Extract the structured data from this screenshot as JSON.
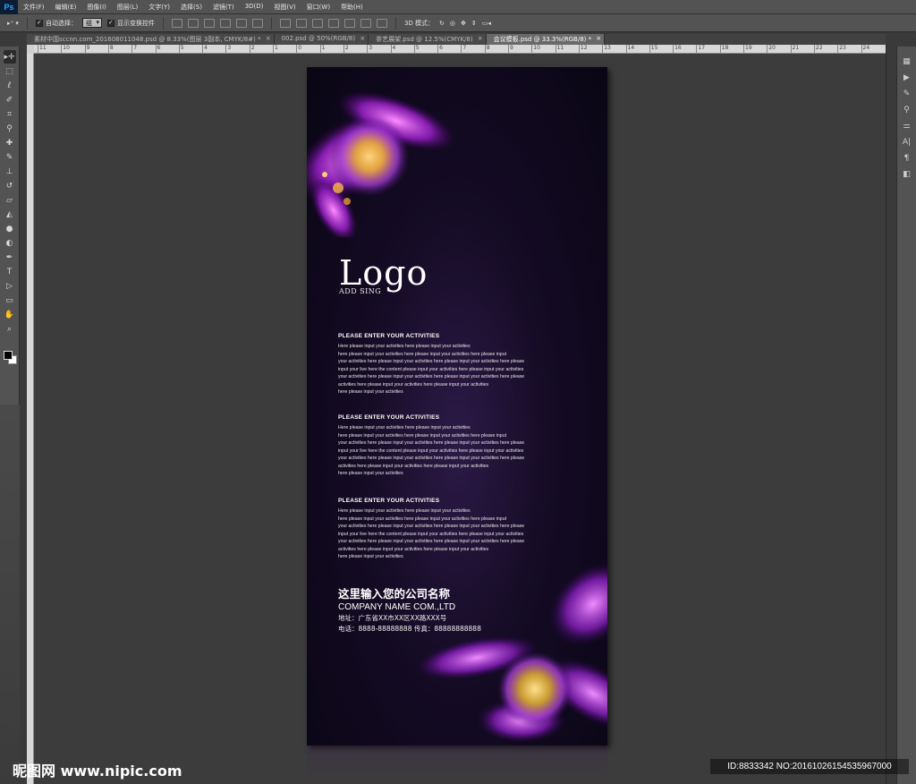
{
  "app": {
    "logo": "Ps"
  },
  "menu": [
    "文件(F)",
    "编辑(E)",
    "图像(I)",
    "图层(L)",
    "文字(Y)",
    "选择(S)",
    "滤镜(T)",
    "3D(D)",
    "视图(V)",
    "窗口(W)",
    "帮助(H)"
  ],
  "options": {
    "auto_select_label": "自动选择：",
    "auto_select_value": "组",
    "show_transform_label": "显示变换控件",
    "mode_3d_label": "3D 模式："
  },
  "tabs": [
    {
      "label": "素材中国sccnn.com_201608011048.psd @ 8.33%(图层 3副本, CMYK/8#) *",
      "active": false
    },
    {
      "label": "002.psd @ 50%(RGB/8)",
      "active": false
    },
    {
      "label": "茶艺展架.psd @ 12.5%(CMYK/8)",
      "active": false
    },
    {
      "label": "会议模板.psd @ 33.3%(RGB/8) *",
      "active": true
    }
  ],
  "ruler_ticks": [
    "11",
    "10",
    "9",
    "8",
    "7",
    "6",
    "5",
    "4",
    "3",
    "2",
    "1",
    "0",
    "1",
    "2",
    "3",
    "4",
    "5",
    "6",
    "7",
    "8",
    "9",
    "10",
    "11",
    "12",
    "13",
    "14",
    "15",
    "16",
    "17",
    "18",
    "19",
    "20",
    "21",
    "22",
    "23",
    "24"
  ],
  "tools": [
    "move-icon",
    "marquee-icon",
    "lasso-icon",
    "quick-select-icon",
    "crop-icon",
    "eyedropper-icon",
    "healing-icon",
    "brush-icon",
    "stamp-icon",
    "history-brush-icon",
    "eraser-icon",
    "bucket-icon",
    "blur-icon",
    "dodge-icon",
    "pen-icon",
    "type-icon",
    "path-select-icon",
    "shape-icon",
    "hand-icon",
    "zoom-icon"
  ],
  "poster": {
    "logo": "Logo",
    "logo_sub": "ADD SING",
    "sections": [
      {
        "title": "PLEASE ENTER YOUR ACTIVITIES",
        "lines": [
          "Here please input your activities here please input your activities",
          "here please input your activities here please input your activities here please input",
          "your activities here please input your activities here please input your activities here please",
          "input your live here the content please input your activities here please input your activities",
          "your activities here please input your activities here please input your activities here please",
          " activities here please input your activities here please input your activities",
          "here please input your activities"
        ]
      },
      {
        "title": "PLEASE ENTER YOUR ACTIVITIES",
        "lines": [
          "Here please input your activities here please input your activities",
          "here please input your activities here please input your activities here please input",
          "your activities here please input your activities here please input your activities here please",
          "input your live here the content please input your activities here please input your activities",
          "your activities here please input your activities here please input your activities here please",
          " activities here please input your activities here please input your activities",
          "here please input your activities"
        ]
      },
      {
        "title": "PLEASE ENTER YOUR ACTIVITIES",
        "lines": [
          "Here please input your activities here please input your activities",
          "here please input your activities here please input your activities here please input",
          "your activities here please input your activities here please input your activities here please",
          "input your live here the content please input your activities here please input your activities",
          "your activities here please input your activities here please input your activities here please",
          " activities here please input your activities here please input your activities",
          "here please input your activities"
        ]
      }
    ],
    "company_cn": "这里输入您的公司名称",
    "company_en": "COMPANY NAME COM.,LTD",
    "address": "地址：广东省XX市XX区XX路XXX号",
    "phone": "电话：8888-88888888  传真：88888888888"
  },
  "watermark": {
    "left": "昵图网 www.nipic.com",
    "right": "ID:8833342 NO:20161026154535967000"
  },
  "colors": {
    "accent": "#9a3ee0",
    "poster_bg": "#140b24",
    "ui_bg": "#535353"
  }
}
